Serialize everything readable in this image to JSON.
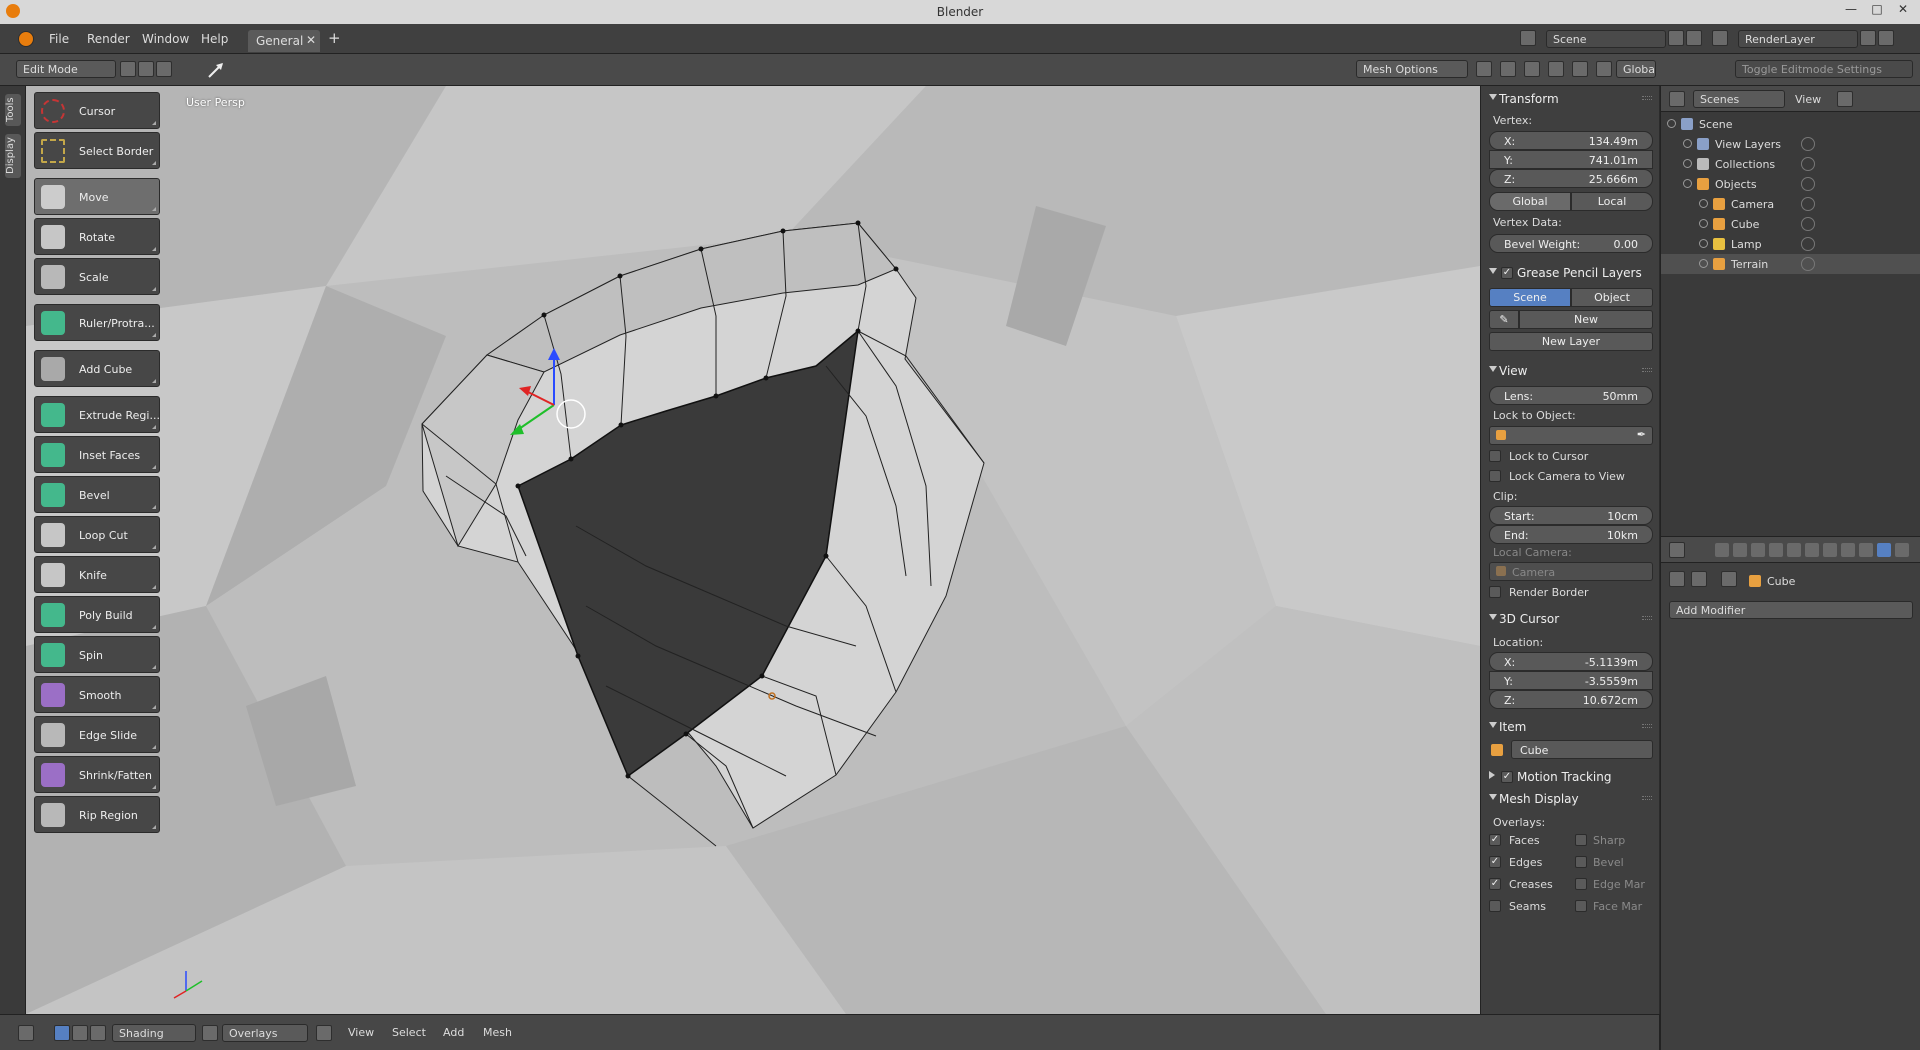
{
  "window": {
    "title": "Blender"
  },
  "menu": {
    "items": [
      "File",
      "Render",
      "Window",
      "Help"
    ],
    "workspace_tab": "General",
    "scene": "Scene",
    "render_layer": "RenderLayer"
  },
  "header": {
    "mode": "Edit Mode",
    "mesh_options": "Mesh Options",
    "orientation": "Global",
    "toggle_editmode": "Toggle Editmode Settings"
  },
  "tabs": {
    "tools": "Tools",
    "display": "Display"
  },
  "viewport": {
    "label": "User Persp"
  },
  "tools": [
    {
      "label": "Cursor",
      "icon": "cursor-icon"
    },
    {
      "label": "Select Border",
      "icon": "select-border-icon"
    },
    {
      "label": "Move",
      "icon": "move-icon"
    },
    {
      "label": "Rotate",
      "icon": "rotate-icon"
    },
    {
      "label": "Scale",
      "icon": "scale-icon"
    },
    {
      "label": "Ruler/Protra...",
      "icon": "ruler-icon"
    },
    {
      "label": "Add Cube",
      "icon": "add-cube-icon"
    },
    {
      "label": "Extrude Regi...",
      "icon": "extrude-icon"
    },
    {
      "label": "Inset Faces",
      "icon": "inset-icon"
    },
    {
      "label": "Bevel",
      "icon": "bevel-icon"
    },
    {
      "label": "Loop Cut",
      "icon": "loop-cut-icon"
    },
    {
      "label": "Knife",
      "icon": "knife-icon"
    },
    {
      "label": "Poly Build",
      "icon": "poly-build-icon"
    },
    {
      "label": "Spin",
      "icon": "spin-icon"
    },
    {
      "label": "Smooth",
      "icon": "smooth-icon"
    },
    {
      "label": "Edge Slide",
      "icon": "edge-slide-icon"
    },
    {
      "label": "Shrink/Fatten",
      "icon": "shrink-icon"
    },
    {
      "label": "Rip Region",
      "icon": "rip-icon"
    }
  ],
  "npanel": {
    "transform": {
      "title": "Transform",
      "vertex_label": "Vertex:",
      "x": {
        "key": "X:",
        "value": "134.49m"
      },
      "y": {
        "key": "Y:",
        "value": "741.01m"
      },
      "z": {
        "key": "Z:",
        "value": "25.666m"
      },
      "global": "Global",
      "local": "Local",
      "vertex_data": "Vertex Data:",
      "bevel_weight": {
        "key": "Bevel Weight:",
        "value": "0.00"
      }
    },
    "grease": {
      "title": "Grease Pencil Layers",
      "scene": "Scene",
      "object": "Object",
      "new": "New",
      "new_layer": "New Layer"
    },
    "view": {
      "title": "View",
      "lens": {
        "key": "Lens:",
        "value": "50mm"
      },
      "lock_to_object": "Lock to Object:",
      "lock_to_cursor": "Lock to Cursor",
      "lock_camera": "Lock Camera to View",
      "clip": "Clip:",
      "start": {
        "key": "Start:",
        "value": "10cm"
      },
      "end": {
        "key": "End:",
        "value": "10km"
      },
      "local_camera": "Local Camera:",
      "camera": "Camera",
      "render_border": "Render Border"
    },
    "cursor": {
      "title": "3D Cursor",
      "location": "Location:",
      "x": {
        "key": "X:",
        "value": "-5.1139m"
      },
      "y": {
        "key": "Y:",
        "value": "-3.5559m"
      },
      "z": {
        "key": "Z:",
        "value": "10.672cm"
      }
    },
    "item": {
      "title": "Item",
      "name": "Cube"
    },
    "motion": {
      "title": "Motion Tracking"
    },
    "mesh_display": {
      "title": "Mesh Display",
      "overlays": "Overlays:",
      "faces": "Faces",
      "edges": "Edges",
      "creases": "Creases",
      "seams": "Seams",
      "sharp": "Sharp",
      "bevel": "Bevel",
      "edge_mar": "Edge Mar",
      "face_mar": "Face Mar"
    }
  },
  "outliner": {
    "display_mode": "Scenes",
    "view": "View",
    "rows": [
      "Scene",
      "View Layers",
      "Collections",
      "Objects",
      "Camera",
      "Cube",
      "Lamp",
      "Terrain"
    ]
  },
  "properties": {
    "object": "Cube",
    "add_modifier": "Add Modifier"
  },
  "bottom": {
    "shading": "Shading",
    "overlays": "Overlays",
    "menus": [
      "View",
      "Select",
      "Add",
      "Mesh"
    ]
  },
  "colors": {
    "accent": "#5680c2",
    "viewport_bg": "#bdbdbd",
    "mesh_face": "#d2d2d2",
    "mesh_inner": "#3a3a3a"
  }
}
